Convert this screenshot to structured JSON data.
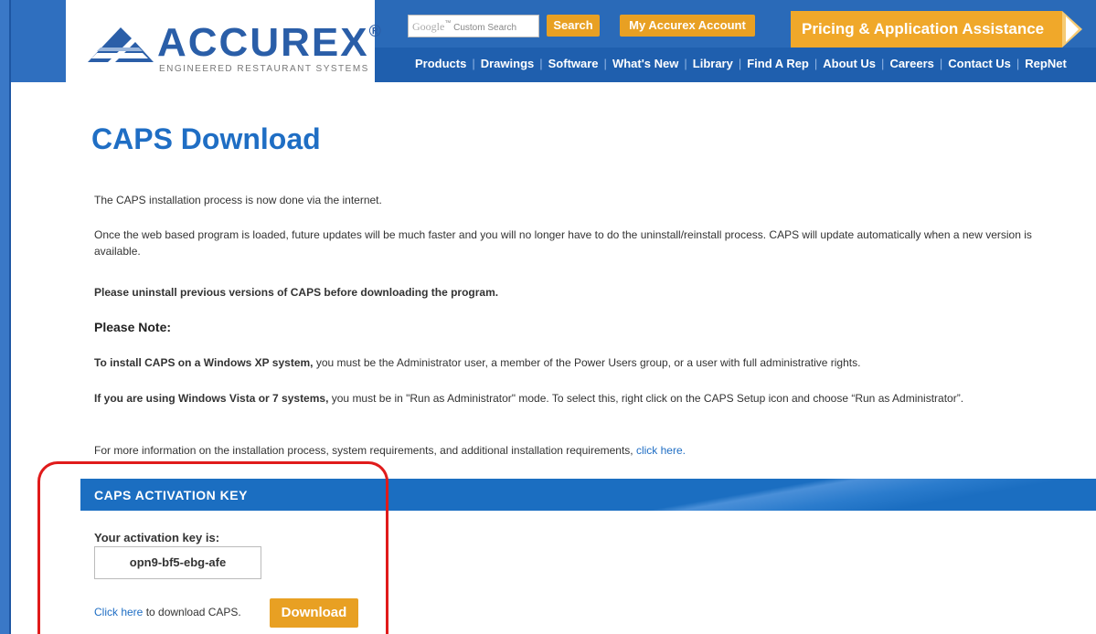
{
  "header": {
    "logo_text": "ACCUREX",
    "logo_reg": "®",
    "logo_sub": "ENGINEERED RESTAURANT SYSTEMS",
    "search_placeholder": "Custom Search",
    "search_google": "Google",
    "search_tm": "™",
    "search_button": "Search",
    "account_button": "My Accurex Account",
    "pricing_button": "Pricing & Application Assistance",
    "nav": [
      "Products",
      "Drawings",
      "Software",
      "What's New",
      "Library",
      "Find A Rep",
      "About Us",
      "Careers",
      "Contact Us",
      "RepNet"
    ]
  },
  "page": {
    "title": "CAPS Download",
    "p1": "The CAPS installation process is now done via the internet.",
    "p2": "Once the web based program is loaded, future updates will be much faster and you will no longer have to do the uninstall/reinstall process. CAPS will update automatically when a new version is available.",
    "p3": "Please uninstall previous versions of CAPS before downloading the program.",
    "note_heading": "Please Note:",
    "p4_bold": "To install CAPS on a Windows XP system,",
    "p4_rest": " you must be the Administrator user, a member of the Power Users group, or a user with full administrative rights.",
    "p5_bold": "If you are using Windows Vista or 7 systems,",
    "p5_rest": " you must be in \"Run as Administrator\" mode. To select this, right click on the CAPS Setup icon and choose “Run as Administrator”.",
    "p6_text": "For more information on the installation process, system requirements, and additional installation requirements, ",
    "p6_link": "click here."
  },
  "activation": {
    "bar_title": "CAPS ACTIVATION KEY",
    "label": "Your activation key is:",
    "key": "opn9-bf5-ebg-afe",
    "click_here": "Click here",
    "download_text": " to download CAPS.",
    "download_button": "Download"
  },
  "colors": {
    "brand_blue": "#1f6ec4",
    "orange": "#e8a023",
    "highlight_red": "#e01b1b"
  }
}
